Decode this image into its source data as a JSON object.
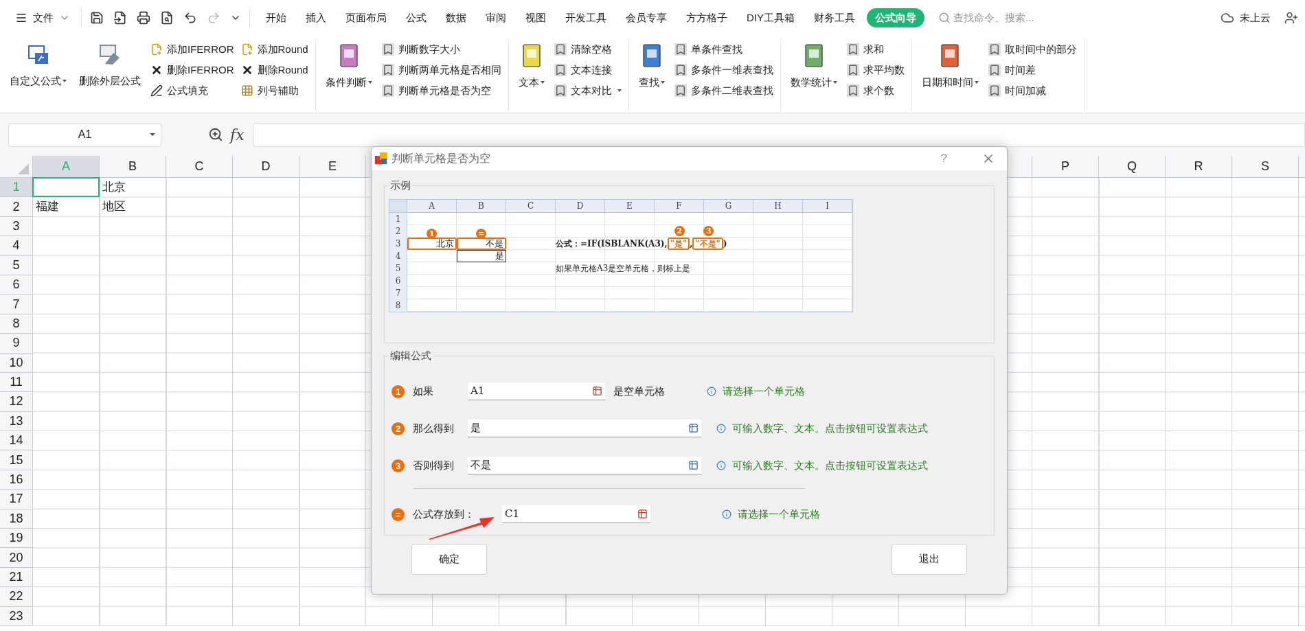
{
  "menu_bar": {
    "file_label": "文件",
    "tabs": [
      {
        "label": "开始",
        "selected": false
      },
      {
        "label": "插入",
        "selected": false
      },
      {
        "label": "页面布局",
        "selected": false
      },
      {
        "label": "公式",
        "selected": false
      },
      {
        "label": "数据",
        "selected": false
      },
      {
        "label": "审阅",
        "selected": false
      },
      {
        "label": "视图",
        "selected": false
      },
      {
        "label": "开发工具",
        "selected": false
      },
      {
        "label": "会员专享",
        "selected": false
      },
      {
        "label": "方方格子",
        "selected": false
      },
      {
        "label": "DIY工具箱",
        "selected": false
      },
      {
        "label": "财务工具",
        "selected": false
      },
      {
        "label": "公式向导",
        "selected": true
      }
    ],
    "search": {
      "placeholder": "查找命令、搜索..."
    },
    "cloud_label": "未上云"
  },
  "ribbon": {
    "groups": [
      {
        "large": [
          {
            "label": "自定义公式",
            "kind": "wizard",
            "dropdown": true,
            "color": "#3b6fc4"
          },
          {
            "label": "删除外层公式",
            "kind": "eraser",
            "dropdown": false,
            "color": "#7a8aa0"
          }
        ],
        "columns": [
          [
            {
              "label": "添加IFERROR",
              "kind": "add",
              "dropdown": false
            },
            {
              "label": "删除IFERROR",
              "kind": "remove",
              "dropdown": false
            },
            {
              "label": "公式填充",
              "kind": "fill",
              "dropdown": false
            }
          ],
          [
            {
              "label": "添加Round",
              "kind": "add",
              "dropdown": false
            },
            {
              "label": "删除Round",
              "kind": "remove",
              "dropdown": false
            },
            {
              "label": "列号辅助",
              "kind": "grid",
              "dropdown": false
            }
          ]
        ]
      },
      {
        "large": [
          {
            "label": "条件判断",
            "kind": "book",
            "dropdown": true,
            "color": "#c77bc4"
          }
        ],
        "columns": [
          [
            {
              "label": "判断数字大小",
              "kind": "bookmark",
              "dropdown": false
            },
            {
              "label": "判断两单元格是否相同",
              "kind": "bookmark",
              "dropdown": false
            },
            {
              "label": "判断单元格是否为空",
              "kind": "bookmark",
              "dropdown": false
            }
          ]
        ]
      },
      {
        "large": [
          {
            "label": "文本",
            "kind": "book",
            "dropdown": true,
            "color": "#e8d84a"
          }
        ],
        "columns": [
          [
            {
              "label": "清除空格",
              "kind": "bookmark",
              "dropdown": false
            },
            {
              "label": "文本连接",
              "kind": "bookmark",
              "dropdown": false
            },
            {
              "label": "文本对比",
              "kind": "bookmark",
              "dropdown": true
            }
          ]
        ]
      },
      {
        "large": [
          {
            "label": "查找",
            "kind": "book",
            "dropdown": true,
            "color": "#3f7fd0"
          }
        ],
        "columns": [
          [
            {
              "label": "单条件查找",
              "kind": "bookmark",
              "dropdown": false
            },
            {
              "label": "多条件一维表查找",
              "kind": "bookmark",
              "dropdown": false
            },
            {
              "label": "多条件二维表查找",
              "kind": "bookmark",
              "dropdown": false
            }
          ]
        ]
      },
      {
        "large": [
          {
            "label": "数学统计",
            "kind": "book",
            "dropdown": true,
            "color": "#6fae6a"
          }
        ],
        "columns": [
          [
            {
              "label": "求和",
              "kind": "bookmark",
              "dropdown": false
            },
            {
              "label": "求平均数",
              "kind": "bookmark",
              "dropdown": false
            },
            {
              "label": "求个数",
              "kind": "bookmark",
              "dropdown": false
            }
          ]
        ]
      },
      {
        "large": [
          {
            "label": "日期和时间",
            "kind": "book",
            "dropdown": true,
            "color": "#e0623a"
          }
        ],
        "columns": [
          [
            {
              "label": "取时间中的部分",
              "kind": "bookmark",
              "dropdown": false
            },
            {
              "label": "时间差",
              "kind": "bookmark",
              "dropdown": false
            },
            {
              "label": "时间加减",
              "kind": "bookmark",
              "dropdown": false
            }
          ]
        ]
      }
    ]
  },
  "formula_bar": {
    "name_box": "A1",
    "fx_label": "fx"
  },
  "sheet": {
    "columns_left": [
      {
        "label": "A",
        "selected": true
      },
      {
        "label": "B",
        "selected": false
      },
      {
        "label": "C",
        "selected": false
      },
      {
        "label": "D",
        "selected": false
      },
      {
        "label": "E",
        "selected": false
      }
    ],
    "columns_right": [
      {
        "label": "P",
        "selected": false
      },
      {
        "label": "Q",
        "selected": false
      },
      {
        "label": "R",
        "selected": false
      },
      {
        "label": "S",
        "selected": false
      }
    ],
    "rows": [
      {
        "label": "1",
        "selected": true,
        "cells": [
          {
            "active": true
          },
          {
            "text": "北京",
            "active": false
          }
        ]
      },
      {
        "label": "2",
        "selected": false,
        "cells": [
          {
            "text": "福建",
            "active": false
          },
          {
            "text": "地区",
            "active": false
          }
        ]
      },
      {
        "label": "3",
        "selected": false
      },
      {
        "label": "4",
        "selected": false
      },
      {
        "label": "5",
        "selected": false
      },
      {
        "label": "6",
        "selected": false
      },
      {
        "label": "7",
        "selected": false
      },
      {
        "label": "8",
        "selected": false
      },
      {
        "label": "9",
        "selected": false
      },
      {
        "label": "10",
        "selected": false
      },
      {
        "label": "11",
        "selected": false
      },
      {
        "label": "12",
        "selected": false
      },
      {
        "label": "13",
        "selected": false
      },
      {
        "label": "14",
        "selected": false
      },
      {
        "label": "15",
        "selected": false
      },
      {
        "label": "16",
        "selected": false
      },
      {
        "label": "17",
        "selected": false
      },
      {
        "label": "18",
        "selected": false
      },
      {
        "label": "19",
        "selected": false
      },
      {
        "label": "20",
        "selected": false
      },
      {
        "label": "21",
        "selected": false
      },
      {
        "label": "22",
        "selected": false
      },
      {
        "label": "23",
        "selected": false
      }
    ]
  },
  "dialog": {
    "title": "判断单元格是否为空",
    "help_label": "?",
    "example": {
      "legend": "示例",
      "columns": [
        "A",
        "B",
        "C",
        "D",
        "E",
        "F",
        "G",
        "H",
        "I"
      ],
      "rows": [
        "1",
        "2",
        "3",
        "4",
        "5",
        "6",
        "7",
        "8"
      ],
      "cell_a3": {
        "text": "北京",
        "marker": "1"
      },
      "cell_b3": {
        "text": "不是",
        "marker": "="
      },
      "cell_b4": "是",
      "formula": {
        "prefix": "公式：=IF(ISBLANK(A3),",
        "arg2": {
          "text": "\"是\"",
          "marker": "2"
        },
        "comma": ",",
        "arg3": {
          "text": "\"不是\"",
          "marker": "3"
        },
        "suffix": ")"
      },
      "note": "如果单元格A3是空单元格，则标上是"
    },
    "edit": {
      "legend": "编辑公式",
      "fields": [
        {
          "marker": "1",
          "label": "如果",
          "value": "A1",
          "suffix": "是空单元格",
          "hint": "请选择一个单元格",
          "kind": "cell"
        },
        {
          "marker": "2",
          "label": "那么得到",
          "value": "是",
          "hint": "可输入数字、文本。点击按钮可设置表达式",
          "kind": "expression"
        },
        {
          "marker": "3",
          "label": "否则得到",
          "value": "不是",
          "hint": "可输入数字、文本。点击按钮可设置表达式",
          "kind": "expression"
        }
      ],
      "target": {
        "marker": "=",
        "label": "公式存放到：",
        "value": "C1",
        "hint": "请选择一个单元格",
        "kind": "cell"
      }
    },
    "buttons": [
      {
        "label": "确定"
      },
      {
        "label": "退出"
      }
    ]
  }
}
